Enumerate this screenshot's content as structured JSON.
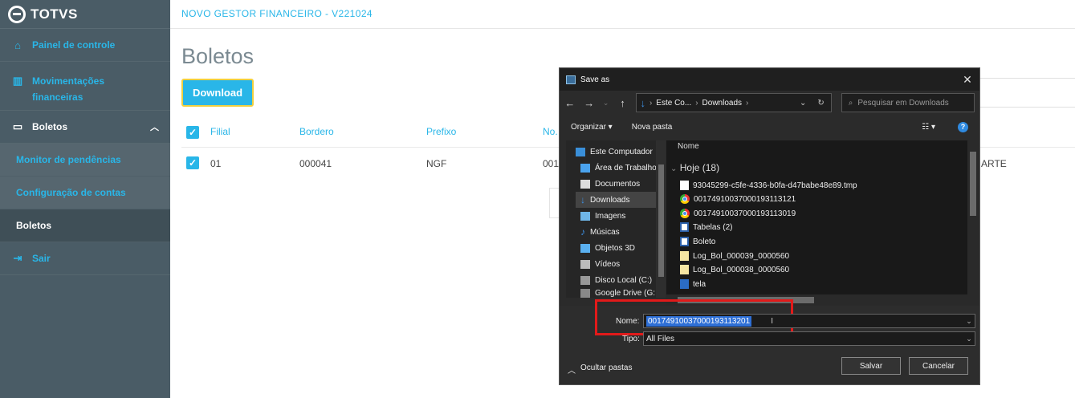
{
  "brand": {
    "name": "TOTVS"
  },
  "app_title": "NOVO GESTOR FINANCEIRO - V221024",
  "sidebar": {
    "items": [
      {
        "label": "Painel de controle",
        "icon": "home-icon"
      },
      {
        "label": "Movimentações financeiras",
        "icon": "chart-icon"
      },
      {
        "label": "Boletos",
        "icon": "monitor-icon",
        "expanded": true
      }
    ],
    "sub_items": [
      {
        "label": "Monitor de pendências"
      },
      {
        "label": "Configuração de contas"
      },
      {
        "label": "Boletos",
        "active": true
      }
    ],
    "logout": {
      "label": "Sair",
      "icon": "logout-icon"
    }
  },
  "page": {
    "title": "Boletos",
    "download_label": "Download",
    "table": {
      "headers": [
        "Filial",
        "Bordero",
        "Prefixo",
        "No."
      ],
      "rows": [
        {
          "filial": "01",
          "bordero": "000041",
          "prefixo": "NGF",
          "numero": "001",
          "extra": "ARTE"
        }
      ]
    }
  },
  "dialog": {
    "title": "Save as",
    "breadcrumb": [
      "Este Co...",
      "Downloads"
    ],
    "search_placeholder": "Pesquisar em Downloads",
    "toolbar": {
      "organize": "Organizar ▾",
      "new_folder": "Nova pasta"
    },
    "nav_items": [
      {
        "label": "Este Computador",
        "icon": "computer-icon"
      },
      {
        "label": "Área de Trabalho",
        "icon": "desktop-icon"
      },
      {
        "label": "Documentos",
        "icon": "documents-icon"
      },
      {
        "label": "Downloads",
        "icon": "downloads-icon",
        "selected": true
      },
      {
        "label": "Imagens",
        "icon": "images-icon"
      },
      {
        "label": "Músicas",
        "icon": "music-icon"
      },
      {
        "label": "Objetos 3D",
        "icon": "objects-3d-icon"
      },
      {
        "label": "Vídeos",
        "icon": "videos-icon"
      },
      {
        "label": "Disco Local (C:)",
        "icon": "disk-icon"
      },
      {
        "label": "Google Drive (G:",
        "icon": "drive-icon"
      }
    ],
    "column_header": "Nome",
    "group_label": "Hoje (18)",
    "files": [
      {
        "name": "93045299-c5fe-4336-b0fa-d47babe48e89.tmp",
        "icon": "file-icon"
      },
      {
        "name": "00174910037000193113121",
        "icon": "chrome-icon"
      },
      {
        "name": "00174910037000193113019",
        "icon": "chrome-icon"
      },
      {
        "name": "Tabelas (2)",
        "icon": "report-icon"
      },
      {
        "name": "Boleto",
        "icon": "report-icon"
      },
      {
        "name": "Log_Bol_000039_0000560",
        "icon": "notepad-icon"
      },
      {
        "name": "Log_Bol_000038_0000560",
        "icon": "notepad-icon"
      },
      {
        "name": "tela",
        "icon": "word-icon"
      }
    ],
    "form": {
      "name_label": "Nome:",
      "name_value": "00174910037000193113201",
      "type_label": "Tipo:",
      "type_value": "All Files",
      "hide_folders": "Ocultar pastas",
      "save": "Salvar",
      "cancel": "Cancelar"
    },
    "colors": {
      "highlight": "#e21a1a",
      "selection": "#2e6fd6"
    }
  },
  "colors": {
    "accent": "#29b6e8",
    "sidebar": "#4a5c66"
  }
}
